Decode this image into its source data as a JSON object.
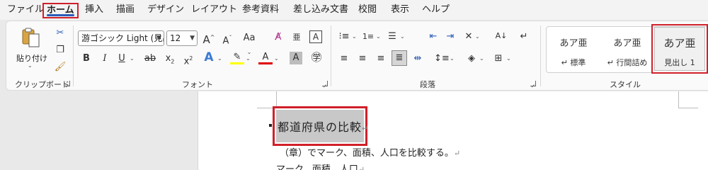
{
  "tabs": [
    {
      "label": "ファイル"
    },
    {
      "label": "ホーム"
    },
    {
      "label": "挿入"
    },
    {
      "label": "描画"
    },
    {
      "label": "デザイン"
    },
    {
      "label": "レイアウト"
    },
    {
      "label": "参考資料"
    },
    {
      "label": "差し込み文書"
    },
    {
      "label": "校閲"
    },
    {
      "label": "表示"
    },
    {
      "label": "ヘルプ"
    }
  ],
  "clipboard": {
    "paste_label": "貼り付け",
    "group_label": "クリップボード"
  },
  "font": {
    "name": "游ゴシック Light (見出",
    "size": "12",
    "group_label": "フォント",
    "aa_label": "Aa",
    "highlight_color": "#ffff00",
    "font_color": "#e00000"
  },
  "paragraph": {
    "group_label": "段落"
  },
  "styles": {
    "group_label": "スタイル",
    "items": [
      {
        "sample": "あア亜",
        "name": "↵ 標準"
      },
      {
        "sample": "あア亜",
        "name": "↵ 行間詰め"
      },
      {
        "sample": "あア亜",
        "name": "見出し 1"
      }
    ]
  },
  "document": {
    "heading": "都道府県の比較",
    "para1": "（章）でマーク、面積、人口を比較する。",
    "para2": "マーク、面積、人口",
    "para_mark": "↵"
  }
}
